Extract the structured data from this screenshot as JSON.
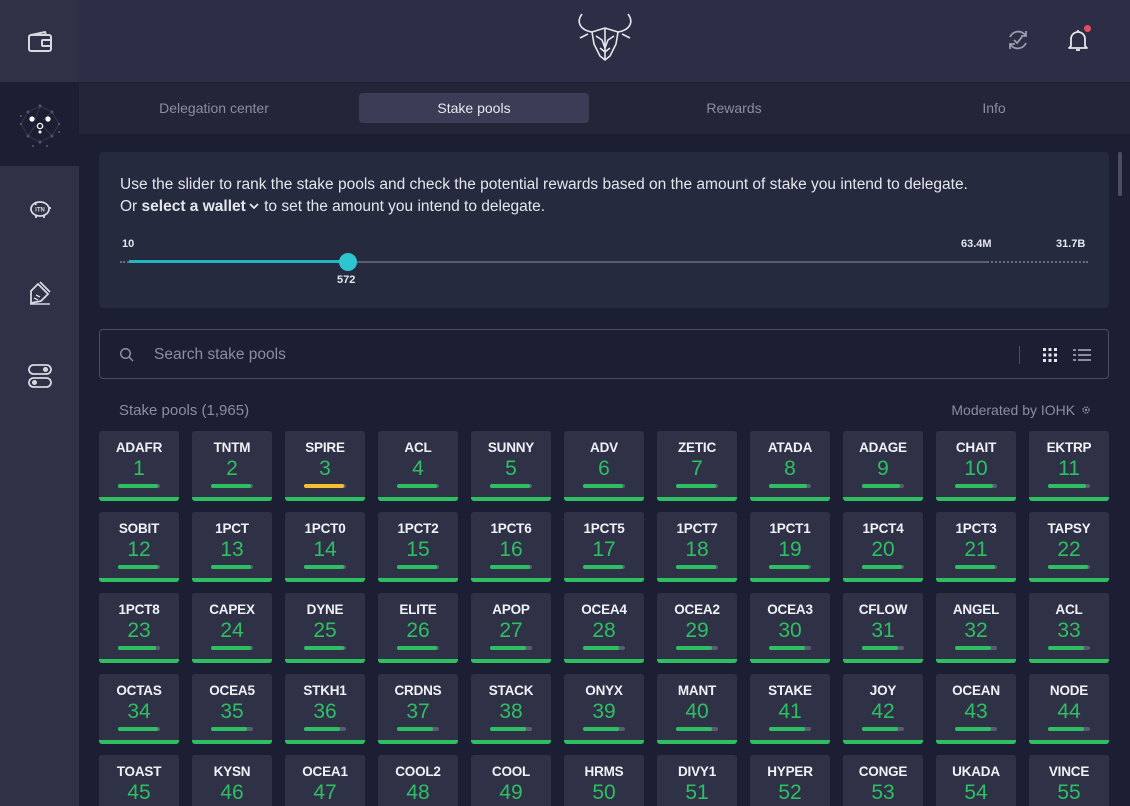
{
  "tabs": [
    {
      "label": "Delegation center",
      "active": false
    },
    {
      "label": "Stake pools",
      "active": true
    },
    {
      "label": "Rewards",
      "active": false
    },
    {
      "label": "Info",
      "active": false
    }
  ],
  "sidebar": {
    "items": [
      {
        "icon": "wallet-icon",
        "active": false
      },
      {
        "icon": "delegation-network-icon",
        "active": true
      },
      {
        "icon": "itn-piggy-bank-icon",
        "active": false
      },
      {
        "icon": "paper-sign-icon",
        "active": false
      },
      {
        "icon": "settings-toggle-icon",
        "active": false
      }
    ]
  },
  "header": {
    "icons": [
      "daedalus-logo-icon",
      "sync-icon",
      "notification-bell-icon"
    ]
  },
  "slider": {
    "line1": "Use the slider to rank the stake pools and check the potential rewards based on the amount of stake you intend to delegate.",
    "line2_prefix": "Or",
    "select_wallet": "select a wallet",
    "line2_suffix": "to set the amount you intend to delegate.",
    "min_label": "10",
    "mid_label": "63.4M",
    "max_label": "31.7B",
    "value_label": "572"
  },
  "search": {
    "placeholder": "Search stake pools"
  },
  "pools_header": {
    "title": "Stake pools (1,965)",
    "moderated": "Moderated by IOHK"
  },
  "colors": {
    "accent_teal": "#2ec4d0",
    "pool_green": "#2fbf63",
    "pool_yellow": "#f5bf2f",
    "notification": "#ea4c5b"
  },
  "pools": [
    {
      "ticker": "ADAFR",
      "rank": "1",
      "sat": 0.95
    },
    {
      "ticker": "TNTM",
      "rank": "2",
      "sat": 0.95
    },
    {
      "ticker": "SPIRE",
      "rank": "3",
      "sat": 0.95,
      "color": "#f5bf2f"
    },
    {
      "ticker": "ACL",
      "rank": "4",
      "sat": 0.95
    },
    {
      "ticker": "SUNNY",
      "rank": "5",
      "sat": 0.95
    },
    {
      "ticker": "ADV",
      "rank": "6",
      "sat": 0.95
    },
    {
      "ticker": "ZETIC",
      "rank": "7",
      "sat": 0.95
    },
    {
      "ticker": "ATADA",
      "rank": "8",
      "sat": 0.9
    },
    {
      "ticker": "ADAGE",
      "rank": "9",
      "sat": 0.9
    },
    {
      "ticker": "CHAIT",
      "rank": "10",
      "sat": 0.9
    },
    {
      "ticker": "EKTRP",
      "rank": "11",
      "sat": 0.9
    },
    {
      "ticker": "SOBIT",
      "rank": "12",
      "sat": 0.95
    },
    {
      "ticker": "1PCT",
      "rank": "13",
      "sat": 0.95
    },
    {
      "ticker": "1PCT0",
      "rank": "14",
      "sat": 0.95
    },
    {
      "ticker": "1PCT2",
      "rank": "15",
      "sat": 0.95
    },
    {
      "ticker": "1PCT6",
      "rank": "16",
      "sat": 0.95
    },
    {
      "ticker": "1PCT5",
      "rank": "17",
      "sat": 0.95
    },
    {
      "ticker": "1PCT7",
      "rank": "18",
      "sat": 0.95
    },
    {
      "ticker": "1PCT1",
      "rank": "19",
      "sat": 0.95
    },
    {
      "ticker": "1PCT4",
      "rank": "20",
      "sat": 0.95
    },
    {
      "ticker": "1PCT3",
      "rank": "21",
      "sat": 0.95
    },
    {
      "ticker": "TAPSY",
      "rank": "22",
      "sat": 0.95
    },
    {
      "ticker": "1PCT8",
      "rank": "23",
      "sat": 0.9
    },
    {
      "ticker": "CAPEX",
      "rank": "24",
      "sat": 0.95
    },
    {
      "ticker": "DYNE",
      "rank": "25",
      "sat": 0.95
    },
    {
      "ticker": "ELITE",
      "rank": "26",
      "sat": 0.95
    },
    {
      "ticker": "APOP",
      "rank": "27",
      "sat": 0.85
    },
    {
      "ticker": "OCEA4",
      "rank": "28",
      "sat": 0.85
    },
    {
      "ticker": "OCEA2",
      "rank": "29",
      "sat": 0.85
    },
    {
      "ticker": "OCEA3",
      "rank": "30",
      "sat": 0.85
    },
    {
      "ticker": "CFLOW",
      "rank": "31",
      "sat": 0.85
    },
    {
      "ticker": "ANGEL",
      "rank": "32",
      "sat": 0.85
    },
    {
      "ticker": "ACL",
      "rank": "33",
      "sat": 0.85
    },
    {
      "ticker": "OCTAS",
      "rank": "34",
      "sat": 0.95
    },
    {
      "ticker": "OCEA5",
      "rank": "35",
      "sat": 0.85
    },
    {
      "ticker": "STKH1",
      "rank": "36",
      "sat": 0.85
    },
    {
      "ticker": "CRDNS",
      "rank": "37",
      "sat": 0.85
    },
    {
      "ticker": "STACK",
      "rank": "38",
      "sat": 0.85
    },
    {
      "ticker": "ONYX",
      "rank": "39",
      "sat": 0.85
    },
    {
      "ticker": "MANT",
      "rank": "40",
      "sat": 0.85
    },
    {
      "ticker": "STAKE",
      "rank": "41",
      "sat": 0.85
    },
    {
      "ticker": "JOY",
      "rank": "42",
      "sat": 0.85
    },
    {
      "ticker": "OCEAN",
      "rank": "43",
      "sat": 0.85
    },
    {
      "ticker": "NODE",
      "rank": "44",
      "sat": 0.85
    },
    {
      "ticker": "TOAST",
      "rank": "45",
      "sat": 0.9
    },
    {
      "ticker": "KYSN",
      "rank": "46",
      "sat": 0.9
    },
    {
      "ticker": "OCEA1",
      "rank": "47",
      "sat": 0.9
    },
    {
      "ticker": "COOL2",
      "rank": "48",
      "sat": 0.9
    },
    {
      "ticker": "COOL",
      "rank": "49",
      "sat": 0.9
    },
    {
      "ticker": "HRMS",
      "rank": "50",
      "sat": 0.9
    },
    {
      "ticker": "DIVY1",
      "rank": "51",
      "sat": 0.9
    },
    {
      "ticker": "HYPER",
      "rank": "52",
      "sat": 0.9
    },
    {
      "ticker": "CONGE",
      "rank": "53",
      "sat": 0.9
    },
    {
      "ticker": "UKADA",
      "rank": "54",
      "sat": 0.9
    },
    {
      "ticker": "VINCE",
      "rank": "55",
      "sat": 0.9
    }
  ]
}
